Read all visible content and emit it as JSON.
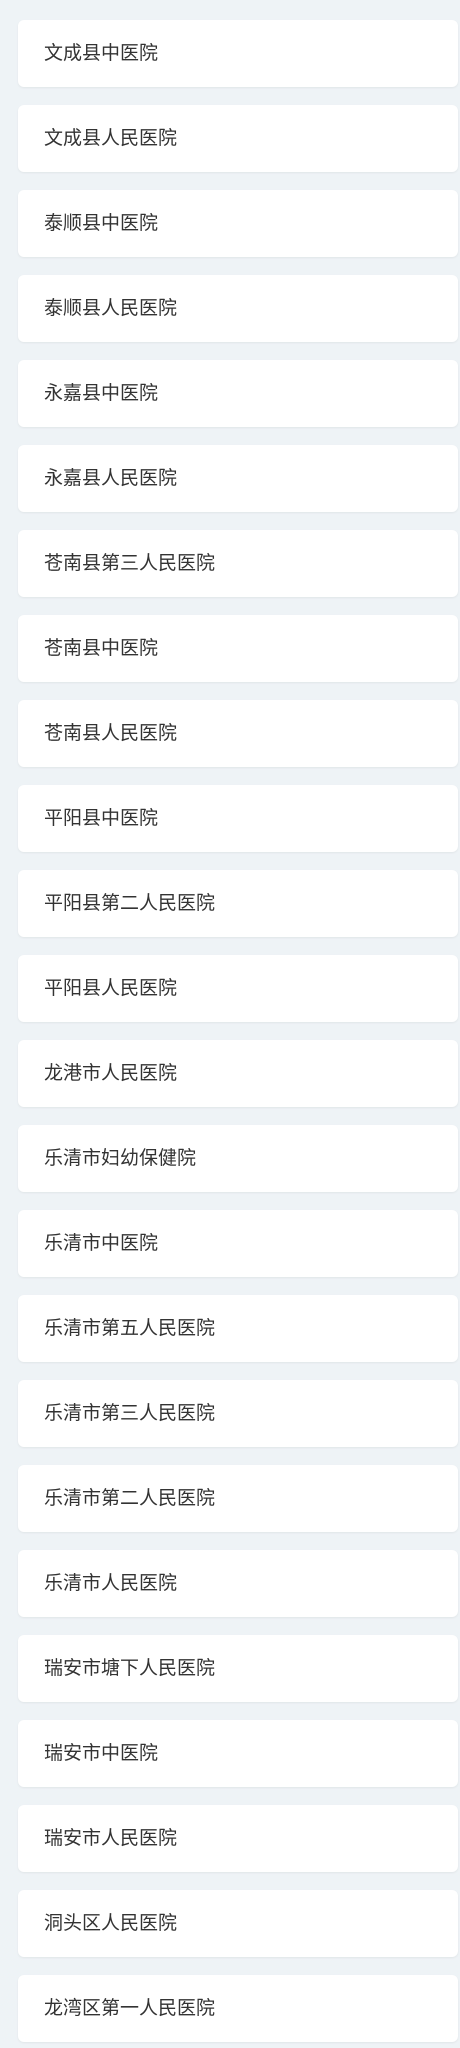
{
  "hospitals": [
    "文成县中医院",
    "文成县人民医院",
    "泰顺县中医院",
    "泰顺县人民医院",
    "永嘉县中医院",
    "永嘉县人民医院",
    "苍南县第三人民医院",
    "苍南县中医院",
    "苍南县人民医院",
    "平阳县中医院",
    "平阳县第二人民医院",
    "平阳县人民医院",
    "龙港市人民医院",
    "乐清市妇幼保健院",
    "乐清市中医院",
    "乐清市第五人民医院",
    "乐清市第三人民医院",
    "乐清市第二人民医院",
    "乐清市人民医院",
    "瑞安市塘下人民医院",
    "瑞安市中医院",
    "瑞安市人民医院",
    "洞头区人民医院",
    "龙湾区第一人民医院"
  ]
}
